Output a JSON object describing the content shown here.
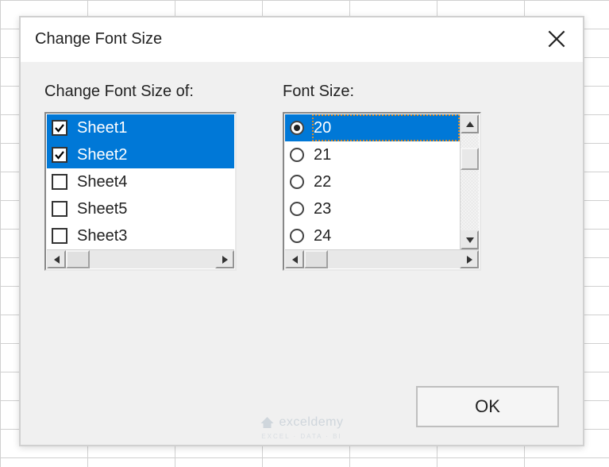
{
  "dialog": {
    "title": "Change Font Size",
    "sheets_label": "Change Font Size of:",
    "font_label": "Font Size:",
    "ok_label": "OK"
  },
  "sheets": [
    {
      "label": "Sheet1",
      "checked": true,
      "selected": true
    },
    {
      "label": "Sheet2",
      "checked": true,
      "selected": true
    },
    {
      "label": "Sheet4",
      "checked": false,
      "selected": false
    },
    {
      "label": "Sheet5",
      "checked": false,
      "selected": false
    },
    {
      "label": "Sheet3",
      "checked": false,
      "selected": false
    }
  ],
  "font_sizes": [
    {
      "label": "20",
      "selected": true
    },
    {
      "label": "21",
      "selected": false
    },
    {
      "label": "22",
      "selected": false
    },
    {
      "label": "23",
      "selected": false
    },
    {
      "label": "24",
      "selected": false
    }
  ],
  "watermark": {
    "brand": "exceldemy",
    "sub": "EXCEL · DATA · BI"
  }
}
